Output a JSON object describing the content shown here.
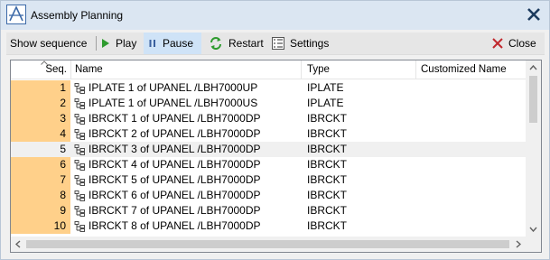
{
  "window": {
    "title": "Assembly Planning"
  },
  "toolbar": {
    "show_sequence": "Show sequence",
    "play": "Play",
    "pause": "Pause",
    "restart": "Restart",
    "settings": "Settings",
    "close": "Close"
  },
  "table": {
    "columns": {
      "seq": "Seq.",
      "name": "Name",
      "type": "Type",
      "customized": "Customized Name"
    },
    "rows": [
      {
        "seq": "1",
        "name": "IPLATE 1 of UPANEL /LBH7000UP",
        "type": "IPLATE"
      },
      {
        "seq": "2",
        "name": "IPLATE 1 of UPANEL /LBH7000US",
        "type": "IPLATE"
      },
      {
        "seq": "3",
        "name": "IBRCKT 1 of UPANEL /LBH7000DP",
        "type": "IBRCKT"
      },
      {
        "seq": "4",
        "name": "IBRCKT 2 of UPANEL /LBH7000DP",
        "type": "IBRCKT"
      },
      {
        "seq": "5",
        "name": "IBRCKT 3 of UPANEL /LBH7000DP",
        "type": "IBRCKT"
      },
      {
        "seq": "6",
        "name": "IBRCKT 4 of UPANEL /LBH7000DP",
        "type": "IBRCKT"
      },
      {
        "seq": "7",
        "name": "IBRCKT 5 of UPANEL /LBH7000DP",
        "type": "IBRCKT"
      },
      {
        "seq": "8",
        "name": "IBRCKT 6 of UPANEL /LBH7000DP",
        "type": "IBRCKT"
      },
      {
        "seq": "9",
        "name": "IBRCKT 7 of UPANEL /LBH7000DP",
        "type": "IBRCKT"
      },
      {
        "seq": "10",
        "name": "IBRCKT 8 of UPANEL /LBH7000DP",
        "type": "IBRCKT"
      }
    ],
    "selected_seq": "5"
  },
  "colors": {
    "sequence_highlight": "#ffd08a",
    "title_bar": "#dbe6f2",
    "play_green": "#2e9b2e",
    "close_red": "#c0282d"
  },
  "icons": [
    "app-logo-icon",
    "close-x-icon",
    "play-icon",
    "pause-icon",
    "restart-icon",
    "settings-icon",
    "hierarchy-icon"
  ]
}
